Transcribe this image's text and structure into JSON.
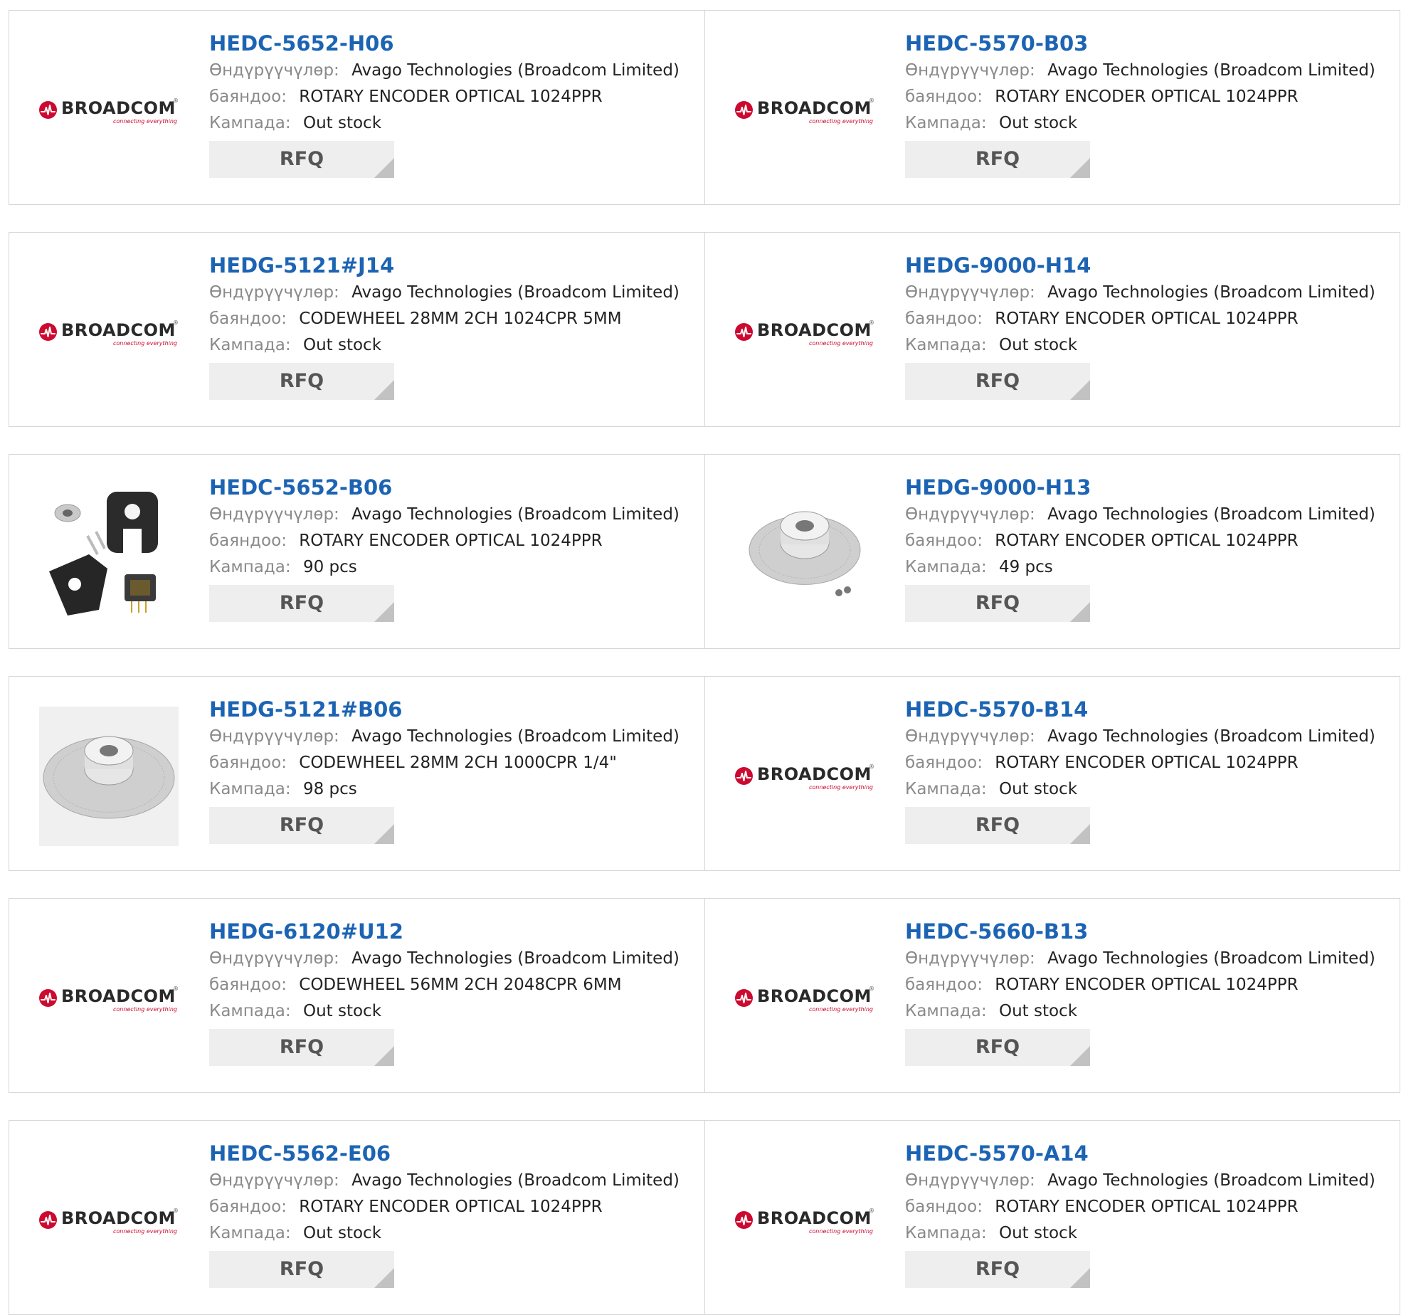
{
  "labels": {
    "manufacturer": "Өндүрүүчүлөр:",
    "description": "баяндоо:",
    "stock": "Кампада:",
    "rfq": "RFQ"
  },
  "brand": {
    "wordmark": "BROADCOM",
    "tagline": "connecting everything",
    "trademark": "®",
    "red": "#cc092f",
    "link_blue": "#1c64b3"
  },
  "products": [
    {
      "pn": "HEDC-5652-H06",
      "manufacturer": "Avago Technologies (Broadcom Limited)",
      "description": "ROTARY ENCODER OPTICAL 1024PPR",
      "stock": "Out stock",
      "image": "broadcom-logo"
    },
    {
      "pn": "HEDC-5570-B03",
      "manufacturer": "Avago Technologies (Broadcom Limited)",
      "description": "ROTARY ENCODER OPTICAL 1024PPR",
      "stock": "Out stock",
      "image": "broadcom-logo"
    },
    {
      "pn": "HEDG-5121#J14",
      "manufacturer": "Avago Technologies (Broadcom Limited)",
      "description": "CODEWHEEL 28MM 2CH 1024CPR 5MM",
      "stock": "Out stock",
      "image": "broadcom-logo"
    },
    {
      "pn": "HEDG-9000-H14",
      "manufacturer": "Avago Technologies (Broadcom Limited)",
      "description": "ROTARY ENCODER OPTICAL 1024PPR",
      "stock": "Out stock",
      "image": "broadcom-logo"
    },
    {
      "pn": "HEDC-5652-B06",
      "manufacturer": "Avago Technologies (Broadcom Limited)",
      "description": "ROTARY ENCODER OPTICAL 1024PPR",
      "stock": "90 pcs",
      "image": "encoder-kit-photo"
    },
    {
      "pn": "HEDG-9000-H13",
      "manufacturer": "Avago Technologies (Broadcom Limited)",
      "description": "ROTARY ENCODER OPTICAL 1024PPR",
      "stock": "49 pcs",
      "image": "codewheel-photo"
    },
    {
      "pn": "HEDG-5121#B06",
      "manufacturer": "Avago Technologies (Broadcom Limited)",
      "description": "CODEWHEEL 28MM 2CH 1000CPR 1/4\"",
      "stock": "98 pcs",
      "image": "codewheel-large-photo"
    },
    {
      "pn": "HEDC-5570-B14",
      "manufacturer": "Avago Technologies (Broadcom Limited)",
      "description": "ROTARY ENCODER OPTICAL 1024PPR",
      "stock": "Out stock",
      "image": "broadcom-logo"
    },
    {
      "pn": "HEDG-6120#U12",
      "manufacturer": "Avago Technologies (Broadcom Limited)",
      "description": "CODEWHEEL 56MM 2CH 2048CPR 6MM",
      "stock": "Out stock",
      "image": "broadcom-logo"
    },
    {
      "pn": "HEDC-5660-B13",
      "manufacturer": "Avago Technologies (Broadcom Limited)",
      "description": "ROTARY ENCODER OPTICAL 1024PPR",
      "stock": "Out stock",
      "image": "broadcom-logo"
    },
    {
      "pn": "HEDC-5562-E06",
      "manufacturer": "Avago Technologies (Broadcom Limited)",
      "description": "ROTARY ENCODER OPTICAL 1024PPR",
      "stock": "Out stock",
      "image": "broadcom-logo"
    },
    {
      "pn": "HEDC-5570-A14",
      "manufacturer": "Avago Technologies (Broadcom Limited)",
      "description": "ROTARY ENCODER OPTICAL 1024PPR",
      "stock": "Out stock",
      "image": "broadcom-logo"
    }
  ]
}
